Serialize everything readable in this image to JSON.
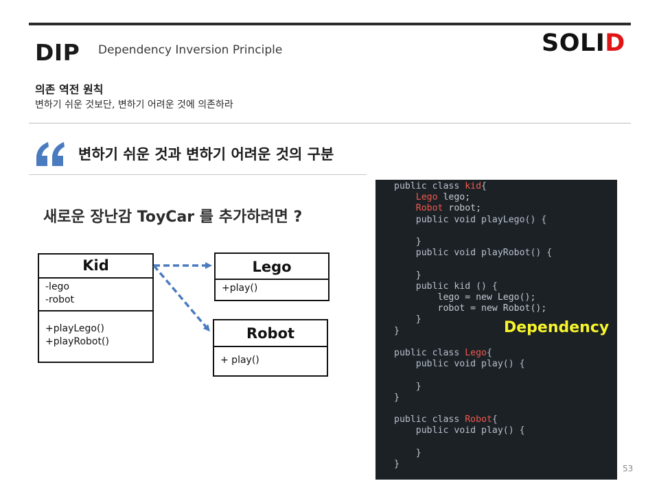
{
  "header": {
    "acronym": "DIP",
    "subtitle": "Dependency Inversion Principle",
    "brand_main": "SOLI",
    "brand_accent": "D",
    "brand_accent_color": "#e01515"
  },
  "principle": {
    "title": "의존 역전 원칙",
    "description": "변하기 쉬운 것보단, 변하기 어려운 것에 의존하라"
  },
  "section": {
    "icon": "quote-icon",
    "heading": "변하기 쉬운 것과 변하기 어려운 것의 구분"
  },
  "question": "새로운 장난감 ToyCar 를 추가하려면 ?",
  "uml": {
    "kid": {
      "name": "Kid",
      "attributes": [
        "-lego",
        "-robot"
      ],
      "operations": [
        "+playLego()",
        "+playRobot()"
      ]
    },
    "lego": {
      "name": "Lego",
      "operations": [
        "+play()"
      ]
    },
    "robot": {
      "name": "Robot",
      "operations": [
        "+ play()"
      ]
    },
    "arrow_color": "#4b7bbf"
  },
  "code": {
    "lines": [
      [
        {
          "t": "public class ",
          "c": "kw"
        },
        {
          "t": "kid",
          "c": "cls"
        },
        {
          "t": "{",
          "c": "kw"
        }
      ],
      [
        {
          "t": "    "
        },
        {
          "t": "Lego",
          "c": "cls"
        },
        {
          "t": " lego;"
        }
      ],
      [
        {
          "t": "    "
        },
        {
          "t": "Robot",
          "c": "cls"
        },
        {
          "t": " robot;"
        }
      ],
      [
        {
          "t": "    public void playLego() {",
          "c": "kw"
        }
      ],
      [
        {
          "t": ""
        }
      ],
      [
        {
          "t": "    }"
        }
      ],
      [
        {
          "t": "    public void playRobot() {",
          "c": "kw"
        }
      ],
      [
        {
          "t": ""
        }
      ],
      [
        {
          "t": "    }"
        }
      ],
      [
        {
          "t": "    public kid () {",
          "c": "kw"
        }
      ],
      [
        {
          "t": "        lego = new Lego();"
        }
      ],
      [
        {
          "t": "        robot = new Robot();"
        }
      ],
      [
        {
          "t": "    }"
        }
      ],
      [
        {
          "t": "}"
        }
      ],
      [
        {
          "t": ""
        }
      ],
      [
        {
          "t": "public class ",
          "c": "kw"
        },
        {
          "t": "Lego",
          "c": "cls"
        },
        {
          "t": "{",
          "c": "kw"
        }
      ],
      [
        {
          "t": "    public void play() {",
          "c": "kw"
        }
      ],
      [
        {
          "t": ""
        }
      ],
      [
        {
          "t": "    }"
        }
      ],
      [
        {
          "t": "}"
        }
      ],
      [
        {
          "t": ""
        }
      ],
      [
        {
          "t": "public class ",
          "c": "kw"
        },
        {
          "t": "Robot",
          "c": "cls"
        },
        {
          "t": "{",
          "c": "kw"
        }
      ],
      [
        {
          "t": "    public void play() {",
          "c": "kw"
        }
      ],
      [
        {
          "t": ""
        }
      ],
      [
        {
          "t": "    }"
        }
      ],
      [
        {
          "t": "}"
        }
      ]
    ],
    "annotation": "Dependency",
    "annotation_color": "#f7f52a"
  },
  "page_number": "53"
}
